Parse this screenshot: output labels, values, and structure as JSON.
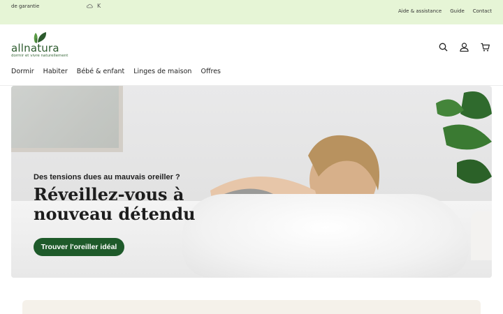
{
  "topbar": {
    "promo": "de garantie",
    "promo_extra": "K",
    "links": [
      "Aide & assistance",
      "Guide",
      "Contact"
    ]
  },
  "header": {
    "logo_word": "allnatura",
    "logo_tagline": "dormir et vivre naturellement",
    "nav": [
      "Dormir",
      "Habiter",
      "Bébé & enfant",
      "Linges de maison",
      "Offres"
    ]
  },
  "hero": {
    "kicker": "Des tensions dues au mauvais oreiller ?",
    "headline_line1": "Réveillez-vous à",
    "headline_line2": "nouveau détendu",
    "cta": "Trouver l'oreiller idéal"
  },
  "colors": {
    "topbar_bg": "#e6f5d6",
    "brand_green": "#1e5a2a",
    "logo_green": "#2c5a2d"
  },
  "icons": [
    "search-icon",
    "user-icon",
    "cart-icon"
  ]
}
